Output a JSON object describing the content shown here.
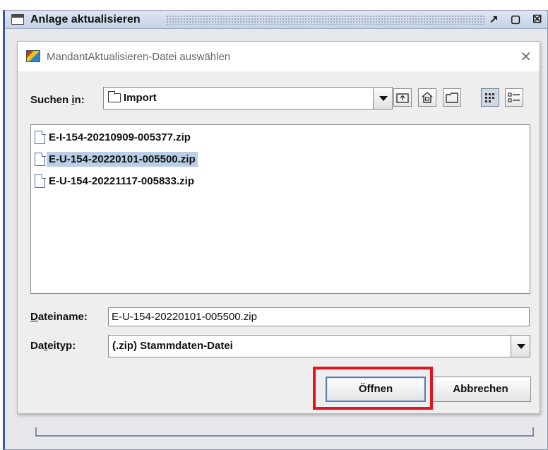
{
  "outer_window": {
    "title": "Anlage aktualisieren",
    "controls": {
      "restore": "↗",
      "maximize": "▢",
      "close": "☒"
    }
  },
  "dialog": {
    "title": "MandantAktualisieren-Datei auswählen",
    "close_glyph": "✕",
    "look_in": {
      "label_pre": "Suchen ",
      "label_mnemonic": "i",
      "label_post": "n:",
      "value": "Import"
    },
    "toolbar": [
      "up-folder-icon",
      "home-icon",
      "new-folder-icon",
      "list-view-icon",
      "details-view-icon"
    ],
    "files": [
      {
        "name": "E-I-154-20210909-005377.zip",
        "selected": false
      },
      {
        "name": "E-U-154-20220101-005500.zip",
        "selected": true
      },
      {
        "name": "E-U-154-20221117-005833.zip",
        "selected": false
      }
    ],
    "filename": {
      "label_mnemonic": "D",
      "label_rest": "ateiname:",
      "value": "E-U-154-20220101-005500.zip"
    },
    "filetype": {
      "label_pre": "Da",
      "label_mnemonic": "t",
      "label_post": "eityp:",
      "value": "(.zip) Stammdaten-Datei"
    },
    "buttons": {
      "open": "Öffnen",
      "cancel": "Abbrechen"
    }
  },
  "annotation": {
    "color": "#e3141f"
  }
}
